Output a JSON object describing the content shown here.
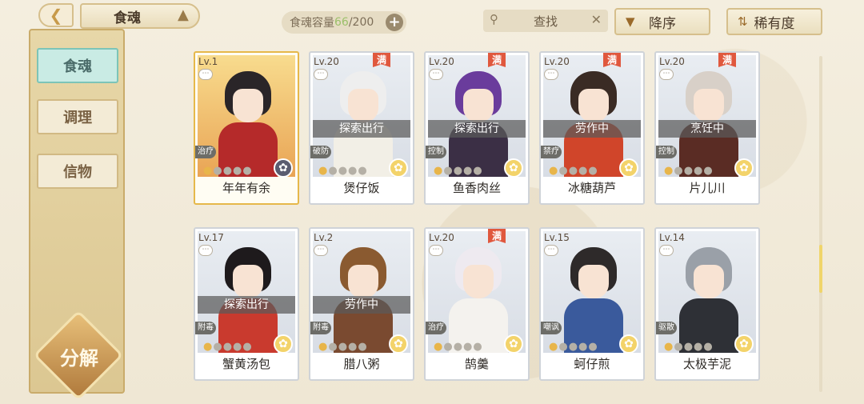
{
  "header": {
    "back_icon": "back-arrow-icon",
    "title": "食魂",
    "home_icon": "home-icon",
    "capacity": {
      "label": "食魂容量",
      "current": "66",
      "separator": "/",
      "max": "200"
    },
    "search_label": "查找",
    "sort_order_label": "降序",
    "sort_key_label": "稀有度"
  },
  "sidebar": {
    "items": [
      {
        "label": "食魂",
        "active": true
      },
      {
        "label": "调理",
        "active": false
      },
      {
        "label": "信物",
        "active": false
      }
    ],
    "decompose_label": "分解"
  },
  "cards": [
    {
      "level": "Lv.1",
      "name": "年年有余",
      "status": "",
      "role": "治疗",
      "full": "",
      "stars_lit": 1,
      "element": "dark",
      "highlight": true,
      "hair": "#2a2528",
      "outfit": "#b52a2a"
    },
    {
      "level": "Lv.20",
      "name": "煲仔饭",
      "status": "探索出行",
      "role": "破防",
      "full": "满",
      "stars_lit": 1,
      "element": "gold",
      "highlight": false,
      "hair": "#eeeeee",
      "outfit": "#f2efe6"
    },
    {
      "level": "Lv.20",
      "name": "鱼香肉丝",
      "status": "探索出行",
      "role": "控制",
      "full": "满",
      "stars_lit": 1,
      "element": "gold",
      "highlight": false,
      "hair": "#6a3c9c",
      "outfit": "#3b2f45"
    },
    {
      "level": "Lv.20",
      "name": "冰糖葫芦",
      "status": "劳作中",
      "role": "禁疗",
      "full": "满",
      "stars_lit": 1,
      "element": "gold",
      "highlight": false,
      "hair": "#3a2b24",
      "outfit": "#d0452a"
    },
    {
      "level": "Lv.20",
      "name": "片儿川",
      "status": "烹饪中",
      "role": "控制",
      "full": "满",
      "stars_lit": 1,
      "element": "gold",
      "highlight": false,
      "hair": "#d8d0c8",
      "outfit": "#5a2c24"
    },
    {
      "level": "Lv.17",
      "name": "蟹黄汤包",
      "status": "探索出行",
      "role": "附毒",
      "full": "",
      "stars_lit": 1,
      "element": "gold",
      "highlight": false,
      "hair": "#1e1a1c",
      "outfit": "#c93a2e"
    },
    {
      "level": "Lv.2",
      "name": "腊八粥",
      "status": "劳作中",
      "role": "附毒",
      "full": "",
      "stars_lit": 1,
      "element": "gold",
      "highlight": false,
      "hair": "#8a5a30",
      "outfit": "#7a4a30"
    },
    {
      "level": "Lv.20",
      "name": "鹄羹",
      "status": "",
      "role": "治疗",
      "full": "满",
      "stars_lit": 1,
      "element": "gold",
      "highlight": false,
      "hair": "#eeeaf0",
      "outfit": "#f4f2ee"
    },
    {
      "level": "Lv.15",
      "name": "蚵仔煎",
      "status": "",
      "role": "嘲讽",
      "full": "",
      "stars_lit": 1,
      "element": "gold",
      "highlight": false,
      "hair": "#2e2a2a",
      "outfit": "#3a5a9c"
    },
    {
      "level": "Lv.14",
      "name": "太极芋泥",
      "status": "",
      "role": "驱散",
      "full": "",
      "stars_lit": 1,
      "element": "gold",
      "highlight": false,
      "hair": "#9aa0a8",
      "outfit": "#2e3036"
    }
  ],
  "colors": {
    "accent_gold": "#e6b84a",
    "active_tab": "#c9ebe4",
    "capacity_current": "#9cc06a"
  }
}
